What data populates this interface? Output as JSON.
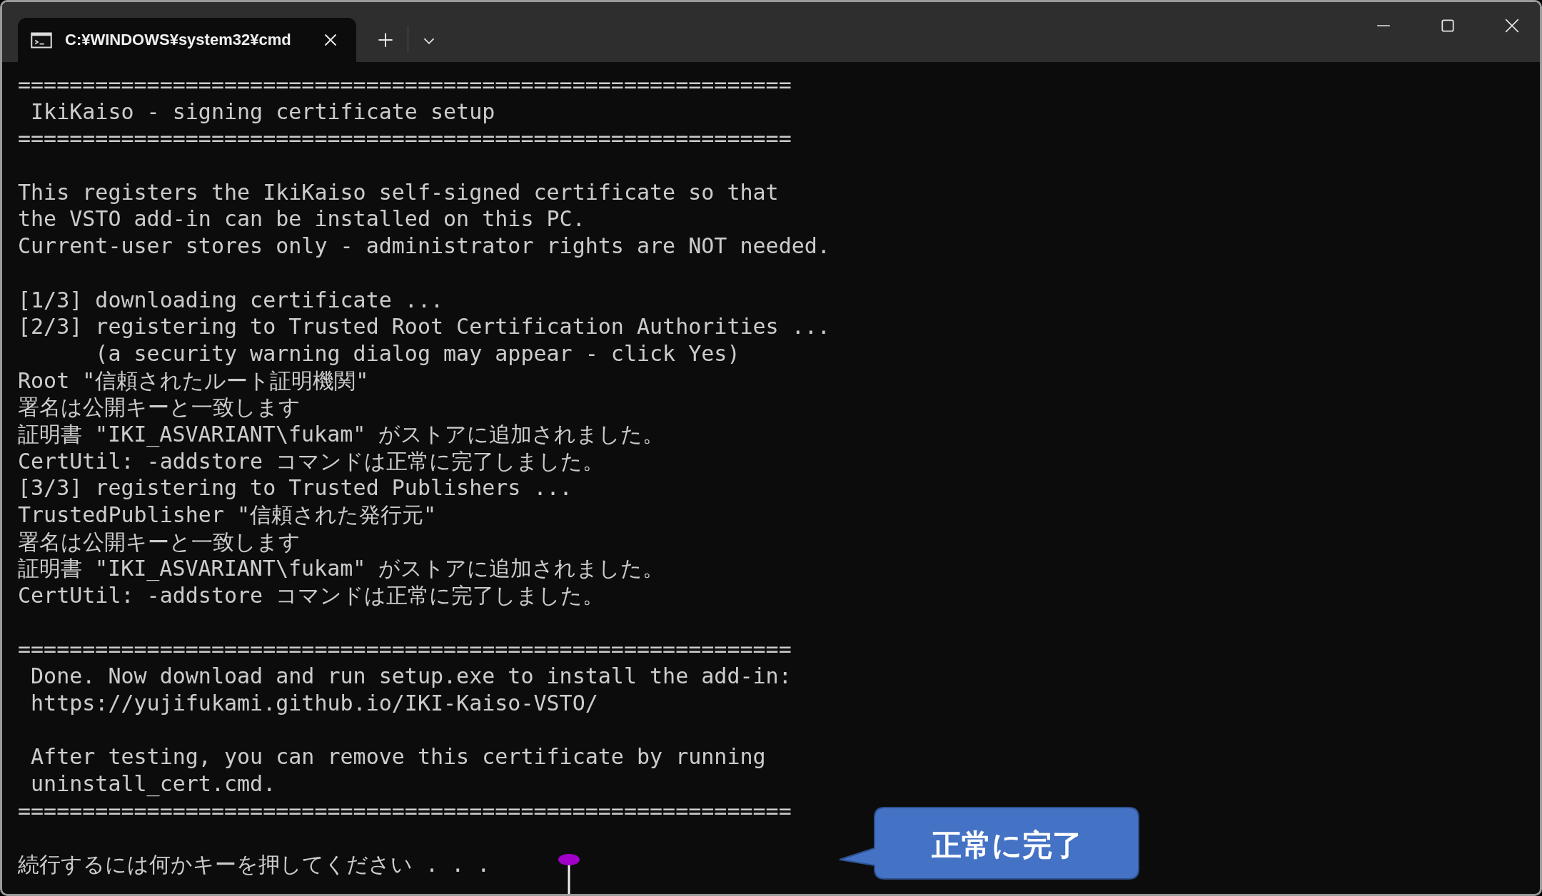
{
  "window": {
    "tabs": [
      {
        "title": "C:¥WINDOWS¥system32¥cmd",
        "selected": true
      }
    ]
  },
  "console": {
    "blocks": [
      [
        "============================================================",
        " IkiKaiso - signing certificate setup",
        "============================================================"
      ],
      [
        "This registers the IkiKaiso self-signed certificate so that",
        "the VSTO add-in can be installed on this PC.",
        "Current-user stores only - administrator rights are NOT needed."
      ],
      [
        "[1/3] downloading certificate ...",
        "[2/3] registering to Trusted Root Certification Authorities ...",
        "      (a security warning dialog may appear - click Yes)",
        "Root \"信頼されたルート証明機関\"",
        "署名は公開キーと一致します",
        "証明書 \"IKI_ASVARIANT\\fukam\" がストアに追加されました。",
        "CertUtil: -addstore コマンドは正常に完了しました。",
        "[3/3] registering to Trusted Publishers ...",
        "TrustedPublisher \"信頼された発行元\"",
        "署名は公開キーと一致します",
        "証明書 \"IKI_ASVARIANT\\fukam\" がストアに追加されました。",
        "CertUtil: -addstore コマンドは正常に完了しました。"
      ],
      [
        "============================================================",
        " Done. Now download and run setup.exe to install the add-in:",
        " https://yujifukami.github.io/IKI-Kaiso-VSTO/"
      ],
      [
        " After testing, you can remove this certificate by running",
        " uninstall_cert.cmd.",
        "============================================================"
      ],
      [
        "続行するには何かキーを押してください . . ."
      ]
    ]
  },
  "callout": {
    "text": "正常に完了"
  }
}
